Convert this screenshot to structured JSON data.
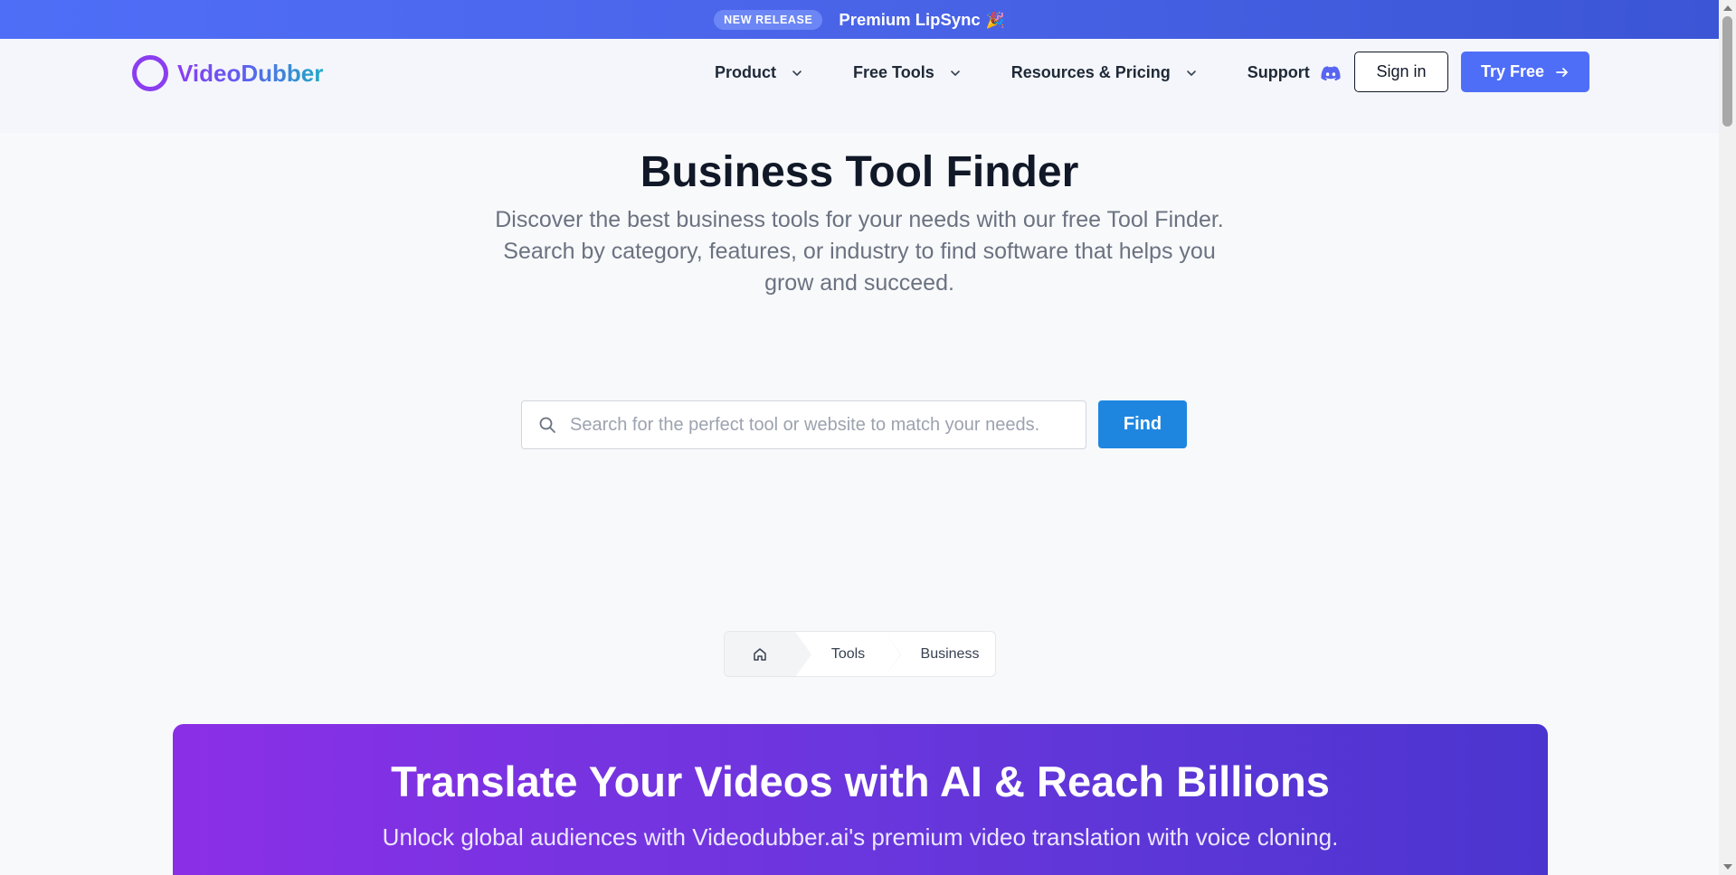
{
  "announcement": {
    "badge": "NEW RELEASE",
    "text": "Premium LipSync",
    "emoji": "🎉"
  },
  "header": {
    "logo_text": "VideoDubber",
    "nav": [
      {
        "label": "Product",
        "has_dropdown": true
      },
      {
        "label": "Free Tools",
        "has_dropdown": true
      },
      {
        "label": "Resources & Pricing",
        "has_dropdown": true
      }
    ],
    "support_label": "Support",
    "signin_label": "Sign in",
    "try_label": "Try Free"
  },
  "hero": {
    "title": "Business Tool Finder",
    "subtitle": "Discover the best business tools for your needs with our free Tool Finder. Search by category, features, or industry to find software that helps you grow and succeed."
  },
  "search": {
    "placeholder": "Search for the perfect tool or website to match your needs.",
    "value": "",
    "button_label": "Find"
  },
  "breadcrumb": {
    "items": [
      "Tools",
      "Business"
    ]
  },
  "promo": {
    "title": "Translate Your Videos with AI & Reach Billions",
    "subtitle": "Unlock global audiences with Videodubber.ai's premium video translation with voice cloning."
  },
  "colors": {
    "primary": "#4f6ef7",
    "find_button": "#1f86e0",
    "promo_start": "#8b2fe6",
    "promo_end": "#4b35cf",
    "logo_purple": "#8b3df0"
  }
}
